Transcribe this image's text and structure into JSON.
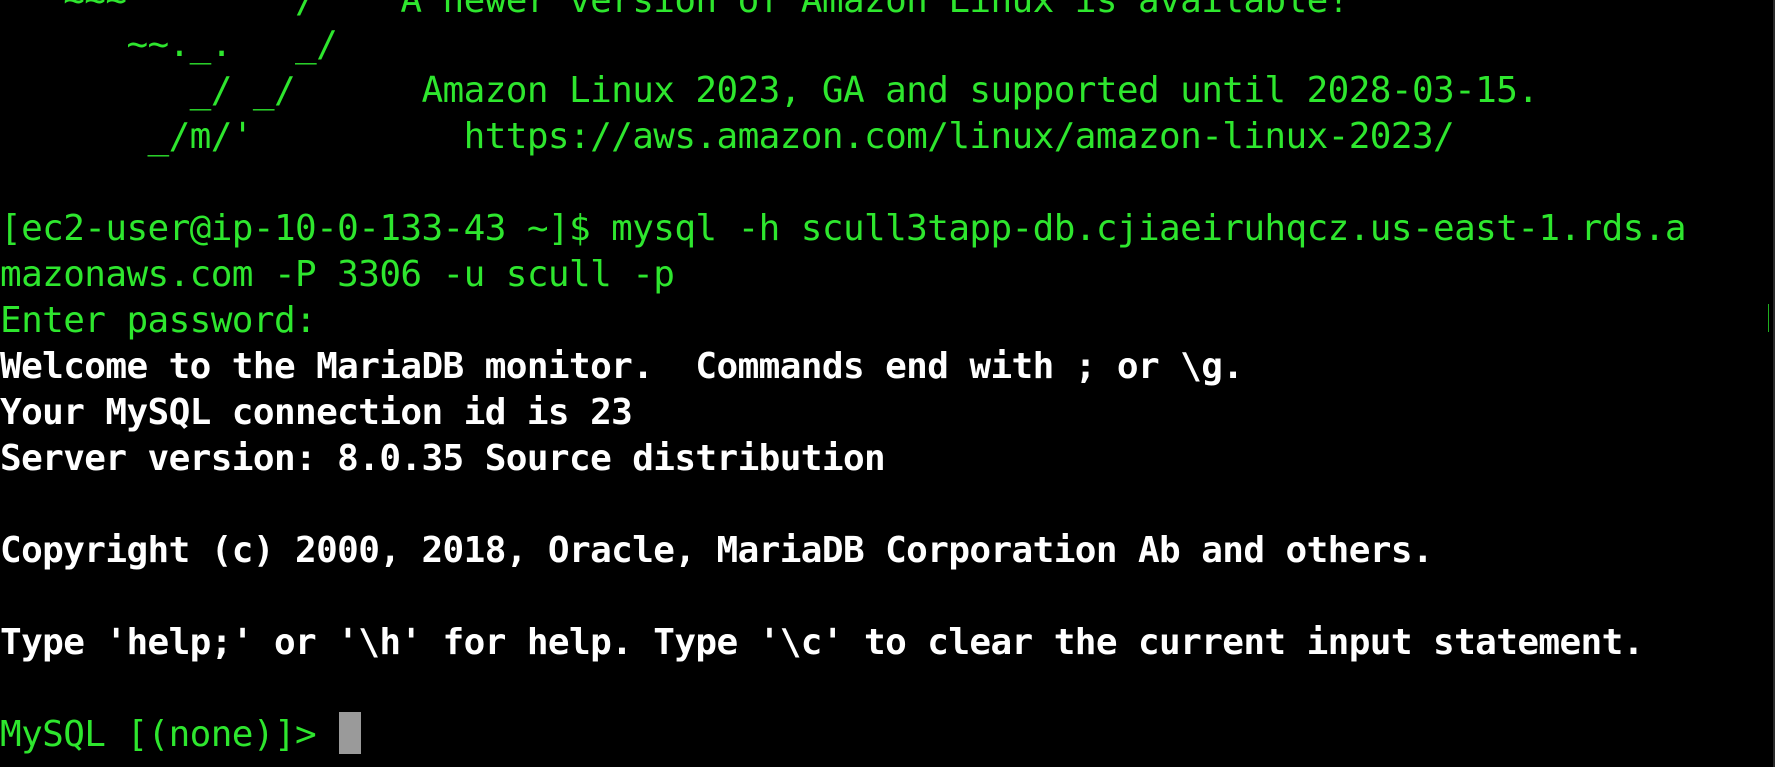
{
  "terminal": {
    "colors": {
      "background": "#000000",
      "prompt_text": "#2ee62e",
      "output_text": "#ffffff",
      "cursor": "#9a9a9a"
    },
    "lines": [
      "   ~~~        /    A newer version of Amazon Linux is available!",
      "      ~~._.   _/",
      "         _/ _/      Amazon Linux 2023, GA and supported until 2028-03-15.",
      "       _/m/'          https://aws.amazon.com/linux/amazon-linux-2023/",
      "",
      "[ec2-user@ip-10-0-133-43 ~]$ mysql -h scull3tapp-db.cjiaeiruhqcz.us-east-1.rds.a",
      "mazonaws.com -P 3306 -u scull -p",
      "Enter password:",
      "Welcome to the MariaDB monitor.  Commands end with ; or \\g.",
      "Your MySQL connection id is 23",
      "Server version: 8.0.35 Source distribution",
      "",
      "Copyright (c) 2000, 2018, Oracle, MariaDB Corporation Ab and others.",
      "",
      "Type 'help;' or '\\h' for help. Type '\\c' to clear the current input statement.",
      "",
      "MySQL [(none)]> "
    ]
  }
}
